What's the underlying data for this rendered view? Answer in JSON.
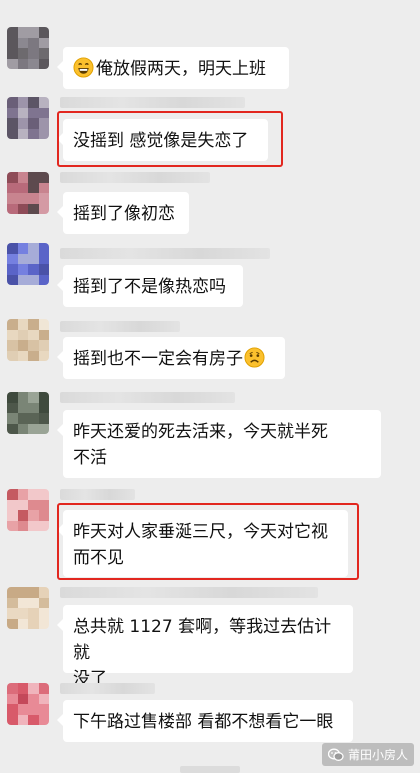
{
  "messages": [
    {
      "text": "俺放假两天，明天上班",
      "emoji": "grinning-face-icon",
      "highlighted": false
    },
    {
      "text": "没摇到 感觉像是失恋了",
      "highlighted": true
    },
    {
      "text": "摇到了像初恋",
      "highlighted": false
    },
    {
      "text": "摇到了不是像热恋吗",
      "highlighted": false
    },
    {
      "text": "摇到也不一定会有房子",
      "emoji": "worried-face-icon",
      "highlighted": false
    },
    {
      "line1": "昨天还爱的死去活来，今天就半死",
      "line2": "不活",
      "highlighted": false
    },
    {
      "line1": "昨天对人家垂涎三尺，今天对它视",
      "line2": "而不见",
      "highlighted": true
    },
    {
      "line1": "总共就 1127 套啊，等我过去估计就",
      "line2": "没了",
      "highlighted": false
    },
    {
      "text": "下午路过售楼部 看都不想看它一眼",
      "highlighted": false
    }
  ],
  "watermark": {
    "text": "莆田小房人",
    "icon": "wechat-official-account-icon"
  },
  "colors": {
    "chat_bg": "#ededed",
    "bubble": "#ffffff",
    "highlight": "#e2271f",
    "text": "#111111"
  }
}
